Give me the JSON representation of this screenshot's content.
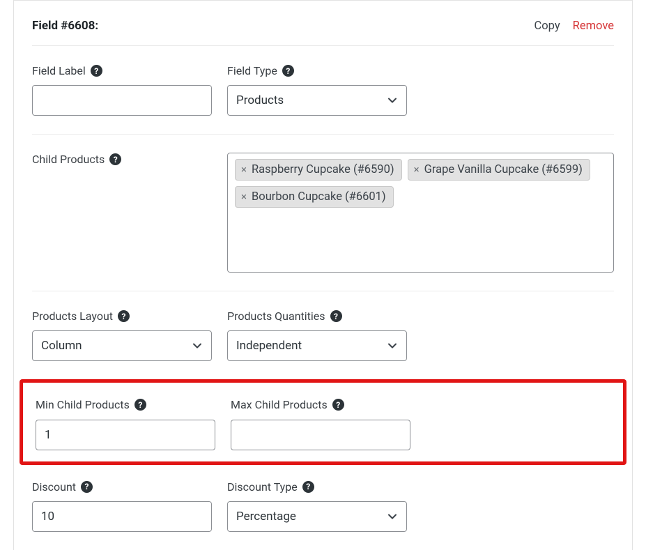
{
  "header": {
    "title": "Field #6608:",
    "copy_label": "Copy",
    "remove_label": "Remove"
  },
  "labels": {
    "field_label": "Field Label",
    "field_type": "Field Type",
    "child_products": "Child Products",
    "products_layout": "Products Layout",
    "products_quantities": "Products Quantities",
    "min_child_products": "Min Child Products",
    "max_child_products": "Max Child Products",
    "discount": "Discount",
    "discount_type": "Discount Type"
  },
  "values": {
    "field_label": "",
    "field_type": "Products",
    "products_layout": "Column",
    "products_quantities": "Independent",
    "min_child_products": "1",
    "max_child_products": "",
    "discount": "10",
    "discount_type": "Percentage"
  },
  "child_products": [
    {
      "label": "Raspberry Cupcake (#6590)"
    },
    {
      "label": "Grape Vanilla Cupcake (#6599)"
    },
    {
      "label": "Bourbon Cupcake (#6601)"
    }
  ],
  "icons": {
    "help": "?",
    "remove_tag": "×"
  }
}
